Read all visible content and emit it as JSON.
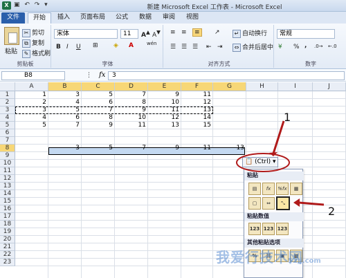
{
  "window": {
    "app_icon_label": "X",
    "title": "新建 Microsoft Excel 工作表 - Microsoft Excel"
  },
  "tabs": [
    "文件",
    "开始",
    "插入",
    "页面布局",
    "公式",
    "数据",
    "审阅",
    "视图"
  ],
  "ribbon": {
    "clipboard": {
      "paste_label": "粘贴",
      "cut_label": "剪切",
      "copy_label": "复制",
      "format_painter_label": "格式刷",
      "group_label": "剪贴板"
    },
    "font": {
      "font_name": "宋体",
      "font_size": "11",
      "bold": "B",
      "italic": "I",
      "underline": "U",
      "wen": "wén",
      "group_label": "字体"
    },
    "alignment": {
      "wrap_text_label": "自动换行",
      "merge_center_label": "合并后居中",
      "group_label": "对齐方式"
    },
    "number": {
      "format_value": "常规",
      "percent": "%",
      "comma": ",",
      "group_label": "数字"
    }
  },
  "formula_bar": {
    "name_box": "B8",
    "fx_label": "fx",
    "formula_value": "3"
  },
  "sheet": {
    "columns": [
      "A",
      "B",
      "C",
      "D",
      "E",
      "F",
      "G",
      "H",
      "I",
      "J"
    ],
    "rows": [
      "1",
      "2",
      "3",
      "4",
      "5",
      "6",
      "7",
      "8",
      "9",
      "10",
      "11",
      "12",
      "13",
      "14",
      "15",
      "16",
      "17",
      "18",
      "19",
      "20",
      "21",
      "22",
      "23"
    ],
    "data": [
      [
        "1",
        "3",
        "5",
        "7",
        "9",
        "11"
      ],
      [
        "2",
        "4",
        "6",
        "8",
        "10",
        "12"
      ],
      [
        "3",
        "5",
        "7",
        "9",
        "11",
        "13"
      ],
      [
        "4",
        "6",
        "8",
        "10",
        "12",
        "14"
      ],
      [
        "5",
        "7",
        "9",
        "11",
        "13",
        "15"
      ]
    ],
    "row8_values": [
      "3",
      "5",
      "7",
      "9",
      "11",
      "13"
    ]
  },
  "paste_options": {
    "button_label": "(Ctrl)",
    "section_paste": "粘贴",
    "section_paste_values": "粘贴数值",
    "section_other": "其他粘贴选项",
    "icon_fx": "fx",
    "icon_pct_fx": "%fx",
    "icon_123": "123",
    "icon_pct": "%"
  },
  "annotations": {
    "label_1": "1",
    "label_2": "2",
    "arrow_color": "#b01a1a"
  },
  "watermark": {
    "text": "我爱行技术网",
    "url": "52ij.com"
  },
  "colors": {
    "selection_fill": "#c4d9f1",
    "header_selected": "#f7d777",
    "file_tab": "#2a5fab"
  }
}
